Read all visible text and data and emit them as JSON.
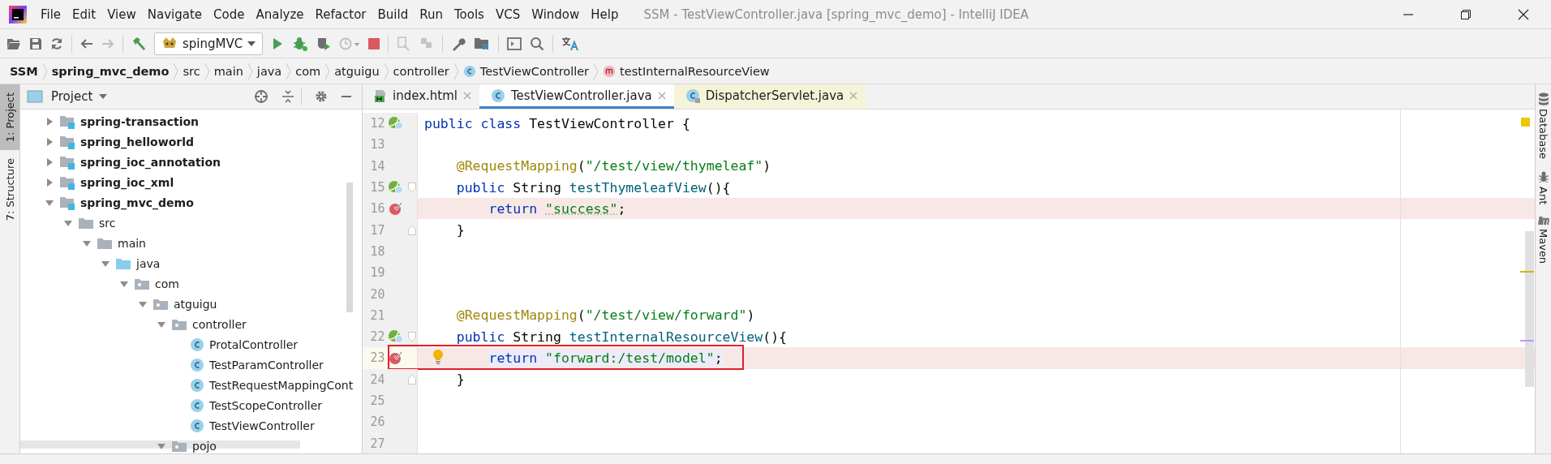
{
  "app_menu": [
    "File",
    "Edit",
    "View",
    "Navigate",
    "Code",
    "Analyze",
    "Refactor",
    "Build",
    "Run",
    "Tools",
    "VCS",
    "Window",
    "Help"
  ],
  "window": {
    "title": "SSM - TestViewController.java [spring_mvc_demo] - IntelliJ IDEA"
  },
  "toolbar": {
    "run_configuration": "spingMVC"
  },
  "breadcrumbs": [
    {
      "label": "SSM",
      "kind": "bold"
    },
    {
      "label": "spring_mvc_demo",
      "kind": "bold"
    },
    {
      "label": "src",
      "kind": "plain"
    },
    {
      "label": "main",
      "kind": "plain"
    },
    {
      "label": "java",
      "kind": "plain"
    },
    {
      "label": "com",
      "kind": "plain"
    },
    {
      "label": "atguigu",
      "kind": "plain"
    },
    {
      "label": "controller",
      "kind": "plain"
    },
    {
      "label": "TestViewController",
      "kind": "class"
    },
    {
      "label": "testInternalResourceView",
      "kind": "method"
    }
  ],
  "left_stripe": [
    {
      "label": "1: Project",
      "selected": true
    },
    {
      "label": "7: Structure",
      "selected": false
    }
  ],
  "project_panel": {
    "title": "Project",
    "tree": [
      {
        "label": "spring-transaction",
        "kind": "module",
        "expanded": false
      },
      {
        "label": "spring_helloworld",
        "kind": "module",
        "expanded": false
      },
      {
        "label": "spring_ioc_annotation",
        "kind": "module",
        "expanded": false
      },
      {
        "label": "spring_ioc_xml",
        "kind": "module",
        "expanded": false
      },
      {
        "label": "spring_mvc_demo",
        "kind": "module",
        "expanded": true,
        "children": [
          {
            "label": "src",
            "kind": "folder",
            "expanded": true,
            "children": [
              {
                "label": "main",
                "kind": "folder",
                "expanded": true,
                "children": [
                  {
                    "label": "java",
                    "kind": "source_folder",
                    "expanded": true,
                    "children": [
                      {
                        "label": "com",
                        "kind": "package",
                        "expanded": true,
                        "children": [
                          {
                            "label": "atguigu",
                            "kind": "package",
                            "expanded": true,
                            "children": [
                              {
                                "label": "controller",
                                "kind": "package",
                                "expanded": true,
                                "children": [
                                  {
                                    "label": "ProtalController",
                                    "kind": "class"
                                  },
                                  {
                                    "label": "TestParamController",
                                    "kind": "class"
                                  },
                                  {
                                    "label": "TestRequestMappingCont",
                                    "kind": "class"
                                  },
                                  {
                                    "label": "TestScopeController",
                                    "kind": "class"
                                  },
                                  {
                                    "label": "TestViewController",
                                    "kind": "class"
                                  }
                                ]
                              },
                              {
                                "label": "pojo",
                                "kind": "package",
                                "expanded": true
                              }
                            ]
                          }
                        ]
                      }
                    ]
                  }
                ]
              }
            ]
          }
        ]
      }
    ]
  },
  "editor_tabs": [
    {
      "label": "index.html",
      "kind": "html",
      "selected": false
    },
    {
      "label": "TestViewController.java",
      "kind": "class",
      "selected": true
    },
    {
      "label": "DispatcherServlet.java",
      "kind": "library",
      "selected": false
    }
  ],
  "editor": {
    "lines": [
      {
        "number": "12",
        "bean": true,
        "fold_start": false,
        "fold_end": false,
        "breakpoint": false,
        "caret": false,
        "annotated": false,
        "tokens": [
          {
            "text": "public class ",
            "kind": "keyword"
          },
          {
            "text": "TestViewController {",
            "kind": "plain"
          }
        ]
      },
      {
        "number": "13",
        "bean": false,
        "fold_start": false,
        "fold_end": false,
        "breakpoint": false,
        "caret": false,
        "annotated": false
      },
      {
        "number": "14",
        "bean": false,
        "fold_start": false,
        "fold_end": false,
        "breakpoint": false,
        "caret": false,
        "annotated": false,
        "tokens": [
          {
            "text": "    @RequestMapping",
            "kind": "annotation"
          },
          {
            "text": "(",
            "kind": "plain"
          },
          {
            "text": "\"/test/view/thymeleaf\"",
            "kind": "string"
          },
          {
            "text": ")",
            "kind": "plain"
          }
        ]
      },
      {
        "number": "15",
        "bean": true,
        "fold_start": true,
        "fold_end": false,
        "breakpoint": false,
        "caret": false,
        "annotated": false,
        "tokens": [
          {
            "text": "    public ",
            "kind": "keyword"
          },
          {
            "text": "String ",
            "kind": "plain"
          },
          {
            "text": "testThymeleafView",
            "kind": "method"
          },
          {
            "text": "(){",
            "kind": "plain"
          }
        ]
      },
      {
        "number": "16",
        "bean": false,
        "fold_start": false,
        "fold_end": false,
        "breakpoint": true,
        "caret": false,
        "annotated": false,
        "tokens": [
          {
            "text": "        return ",
            "kind": "keyword"
          },
          {
            "text": "\"success\"",
            "kind": "string"
          },
          {
            "text": ";",
            "kind": "plain"
          }
        ]
      },
      {
        "number": "17",
        "bean": false,
        "fold_start": false,
        "fold_end": true,
        "breakpoint": false,
        "caret": false,
        "annotated": false,
        "tokens": [
          {
            "text": "    }",
            "kind": "plain"
          }
        ]
      },
      {
        "number": "18",
        "bean": false,
        "fold_start": false,
        "fold_end": false,
        "breakpoint": false,
        "caret": false,
        "annotated": false
      },
      {
        "number": "19",
        "bean": false,
        "fold_start": false,
        "fold_end": false,
        "breakpoint": false,
        "caret": false,
        "annotated": false
      },
      {
        "number": "20",
        "bean": false,
        "fold_start": false,
        "fold_end": false,
        "breakpoint": false,
        "caret": false,
        "annotated": false
      },
      {
        "number": "21",
        "bean": false,
        "fold_start": false,
        "fold_end": false,
        "breakpoint": false,
        "caret": false,
        "annotated": false,
        "tokens": [
          {
            "text": "    @RequestMapping",
            "kind": "annotation"
          },
          {
            "text": "(",
            "kind": "plain"
          },
          {
            "text": "\"/test/view/forward\"",
            "kind": "string"
          },
          {
            "text": ")",
            "kind": "plain"
          }
        ]
      },
      {
        "number": "22",
        "bean": true,
        "fold_start": true,
        "fold_end": false,
        "breakpoint": false,
        "caret": false,
        "annotated": false,
        "tokens": [
          {
            "text": "    public ",
            "kind": "keyword"
          },
          {
            "text": "String ",
            "kind": "plain"
          },
          {
            "text": "testInternalResourceView",
            "kind": "method"
          },
          {
            "text": "(){",
            "kind": "plain"
          }
        ]
      },
      {
        "number": "23",
        "bean": false,
        "fold_start": false,
        "fold_end": false,
        "breakpoint": true,
        "caret": true,
        "annotated": true,
        "tokens": [
          {
            "text": "        return ",
            "kind": "keyword"
          },
          {
            "text": "\"forward:/test/model\"",
            "kind": "string"
          },
          {
            "text": ";",
            "kind": "plain"
          }
        ]
      },
      {
        "number": "24",
        "bean": false,
        "fold_start": false,
        "fold_end": true,
        "breakpoint": false,
        "caret": false,
        "annotated": false,
        "tokens": [
          {
            "text": "    }",
            "kind": "plain"
          }
        ]
      },
      {
        "number": "25",
        "bean": false,
        "fold_start": false,
        "fold_end": false,
        "breakpoint": false,
        "caret": false,
        "annotated": false
      },
      {
        "number": "26",
        "bean": false,
        "fold_start": false,
        "fold_end": false,
        "breakpoint": false,
        "caret": false,
        "annotated": false
      },
      {
        "number": "27",
        "bean": false,
        "fold_start": false,
        "fold_end": false,
        "breakpoint": false,
        "caret": false,
        "annotated": false
      }
    ]
  },
  "right_stripe": [
    "Database",
    "Ant",
    "Maven"
  ]
}
